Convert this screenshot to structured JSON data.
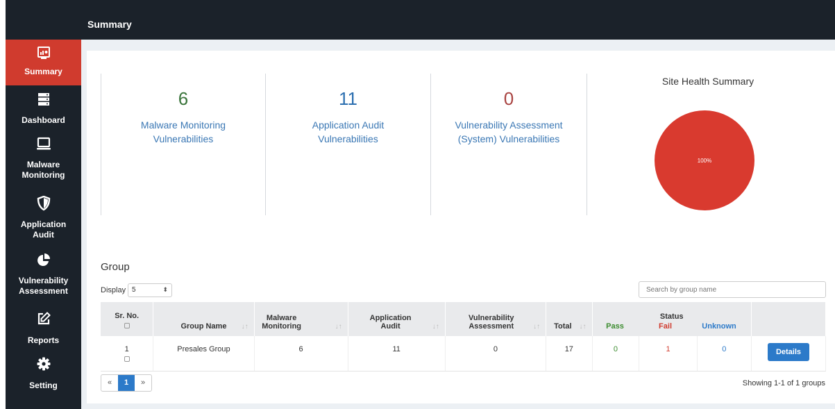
{
  "header": {
    "title": "Summary"
  },
  "sidebar": {
    "items": [
      {
        "label": "Summary",
        "icon": "monitor-chart-icon",
        "active": true
      },
      {
        "label": "Dashboard",
        "icon": "server-icon"
      },
      {
        "label": "Malware Monitoring",
        "icon": "laptop-icon"
      },
      {
        "label": "Application Audit",
        "icon": "shield-icon"
      },
      {
        "label": "Vulnerability Assessment",
        "icon": "pie-chart-icon"
      },
      {
        "label": "Reports",
        "icon": "edit-icon"
      },
      {
        "label": "Setting",
        "icon": "gear-icon"
      }
    ]
  },
  "stats": [
    {
      "value": "6",
      "label": "Malware Monitoring Vulnerabilities",
      "color": "#3c763d"
    },
    {
      "value": "11",
      "label": "Application Audit Vulnerabilities",
      "color": "#2c6fb0"
    },
    {
      "value": "0",
      "label": "Vulnerability Assessment (System) Vulnerabilities",
      "color": "#a94442"
    }
  ],
  "chart_data": {
    "type": "pie",
    "title": "Site Health Summary",
    "slices": [
      {
        "label": "100%",
        "value": 100,
        "color": "#d93a2f"
      }
    ]
  },
  "group": {
    "title": "Group",
    "display_label": "Display",
    "display_value": "5",
    "search_placeholder": "Search by group name",
    "columns": {
      "srno": "Sr. No.",
      "name": "Group Name",
      "malware": "Malware Monitoring",
      "app": "Application Audit",
      "vuln": "Vulnerability Assessment",
      "total": "Total",
      "status": "Status",
      "pass": "Pass",
      "fail": "Fail",
      "unknown": "Unknown"
    },
    "rows": [
      {
        "sr": "1",
        "name": "Presales Group",
        "malware": "6",
        "app": "11",
        "vuln": "0",
        "total": "17",
        "pass": "0",
        "fail": "1",
        "unknown": "0",
        "action": "Details"
      }
    ],
    "pager": {
      "prev": "«",
      "current": "1",
      "next": "»"
    },
    "showing": "Showing 1-1 of 1 groups"
  }
}
